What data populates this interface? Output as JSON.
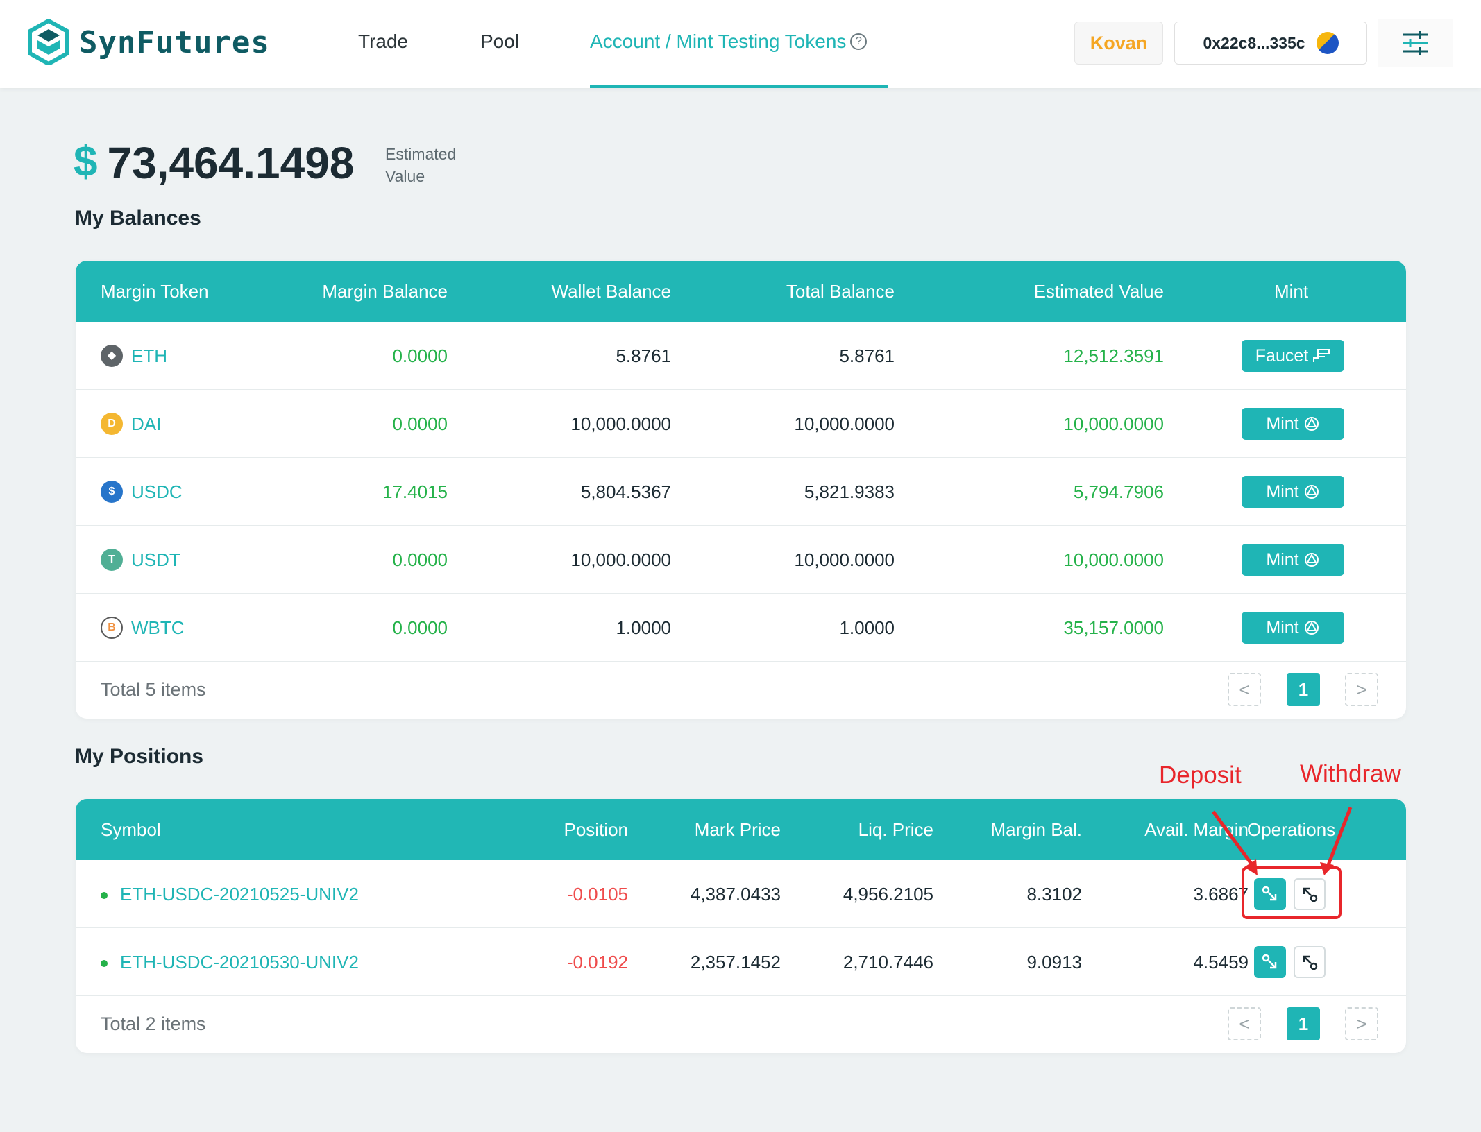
{
  "header": {
    "logo_text": "SynFutures",
    "nav": [
      {
        "label": "Trade"
      },
      {
        "label": "Pool"
      },
      {
        "label": "Account / Mint Testing Tokens",
        "active": true
      }
    ],
    "network": "Kovan",
    "wallet_address": "0x22c8...335c",
    "help_glyph": "?"
  },
  "summary": {
    "currency_symbol": "$",
    "total_value": "73,464.1498",
    "label_line1": "Estimated",
    "label_line2": "Value"
  },
  "balances": {
    "title": "My Balances",
    "columns": [
      "Margin Token",
      "Margin Balance",
      "Wallet Balance",
      "Total Balance",
      "Estimated Value",
      "Mint"
    ],
    "rows": [
      {
        "token": "ETH",
        "icon": "eth-icon",
        "margin_balance": "0.0000",
        "wallet_balance": "5.8761",
        "total_balance": "5.8761",
        "estimated_value": "12,512.3591",
        "action": "Faucet"
      },
      {
        "token": "DAI",
        "icon": "dai-icon",
        "margin_balance": "0.0000",
        "wallet_balance": "10,000.0000",
        "total_balance": "10,000.0000",
        "estimated_value": "10,000.0000",
        "action": "Mint"
      },
      {
        "token": "USDC",
        "icon": "usdc-icon",
        "margin_balance": "17.4015",
        "wallet_balance": "5,804.5367",
        "total_balance": "5,821.9383",
        "estimated_value": "5,794.7906",
        "action": "Mint"
      },
      {
        "token": "USDT",
        "icon": "usdt-icon",
        "margin_balance": "0.0000",
        "wallet_balance": "10,000.0000",
        "total_balance": "10,000.0000",
        "estimated_value": "10,000.0000",
        "action": "Mint"
      },
      {
        "token": "WBTC",
        "icon": "wbtc-icon",
        "margin_balance": "0.0000",
        "wallet_balance": "1.0000",
        "total_balance": "1.0000",
        "estimated_value": "35,157.0000",
        "action": "Mint"
      }
    ],
    "footer": "Total 5 items",
    "page": "1",
    "prev": "<",
    "next": ">"
  },
  "positions": {
    "title": "My Positions",
    "columns": [
      "Symbol",
      "Position",
      "Mark Price",
      "Liq. Price",
      "Margin Bal.",
      "Avail. Margin",
      "Operations"
    ],
    "rows": [
      {
        "symbol": "ETH-USDC-20210525-UNIV2",
        "position": "-0.0105",
        "mark_price": "4,387.0433",
        "liq_price": "4,956.2105",
        "margin_bal": "8.3102",
        "avail_margin": "3.6867"
      },
      {
        "symbol": "ETH-USDC-20210530-UNIV2",
        "position": "-0.0192",
        "mark_price": "2,357.1452",
        "liq_price": "2,710.7446",
        "margin_bal": "9.0913",
        "avail_margin": "4.5459"
      }
    ],
    "footer": "Total 2 items",
    "page": "1",
    "prev": "<",
    "next": ">"
  },
  "annotations": {
    "deposit": "Deposit",
    "withdraw": "Withdraw"
  },
  "colors": {
    "accent": "#1fb5b5",
    "positive": "#25b24a",
    "negative": "#ef4b4b",
    "network": "#f5a623",
    "annotation": "#e8262b"
  }
}
